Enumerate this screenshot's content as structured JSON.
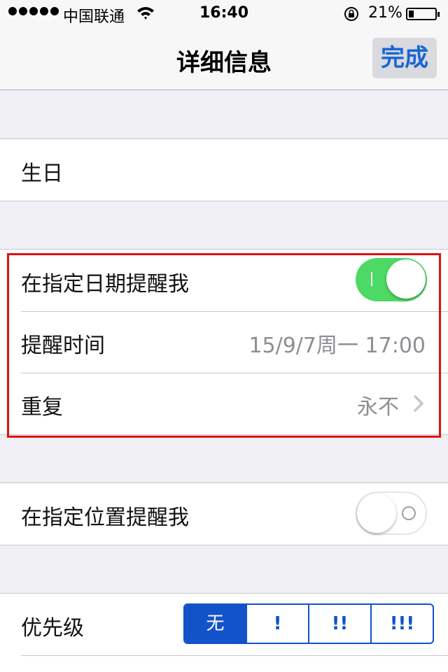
{
  "status_bar": {
    "carrier": "中国联通",
    "time": "16:40",
    "battery": "21%"
  },
  "nav": {
    "title": "详细信息",
    "done_label": "完成"
  },
  "birthday": {
    "label": "生日"
  },
  "date_reminder": {
    "label": "在指定日期提醒我",
    "toggle_on": true,
    "time_label": "提醒时间",
    "time_value": "15/9/7周一 17:00",
    "repeat_label": "重复",
    "repeat_value": "永不"
  },
  "location_reminder": {
    "label": "在指定位置提醒我",
    "toggle_on": false
  },
  "priority": {
    "label": "优先级",
    "options": [
      "无",
      "!",
      "!!",
      "!!!"
    ],
    "selected_index": 0
  },
  "colors": {
    "accent": "#1866d6",
    "toggle_on": "#4cd964",
    "segment": "#1253c9",
    "highlight": "#e01010"
  }
}
